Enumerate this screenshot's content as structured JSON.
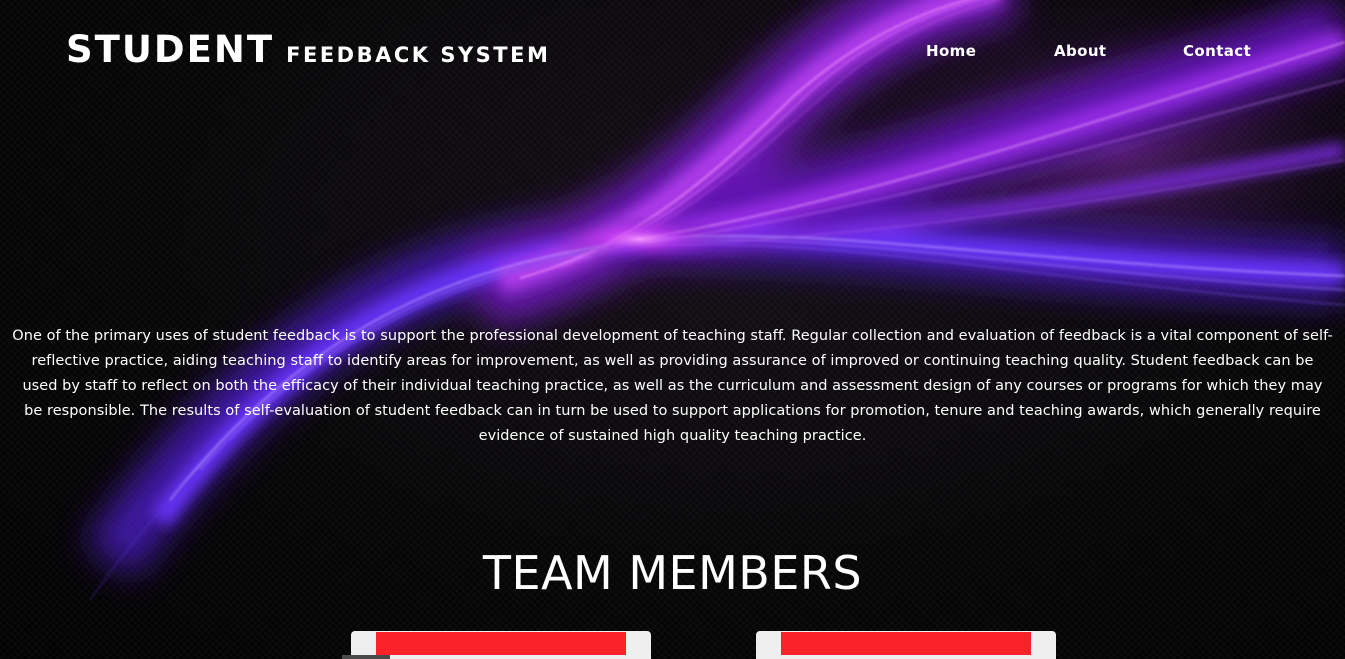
{
  "header": {
    "logo_main": "STUDENT",
    "logo_sub": "FEEDBACK SYSTEM",
    "nav": [
      "Home",
      "About",
      "Contact"
    ]
  },
  "intro": {
    "text": "One of the primary uses of student feedback is to support the professional development of teaching staff. Regular collection and evaluation of feedback is a vital component of self-reflective practice, aiding teaching staff to identify areas for improvement, as well as providing assurance of improved or continuing teaching quality. Student feedback can be used by staff to reflect on both the efficacy of their individual teaching practice, as well as the curriculum and assessment design of any courses or programs for which they may be responsible. The results of self-evaluation of student feedback can in turn be used to support applications for promotion, tenure and teaching awards, which generally require evidence of sustained high quality teaching practice."
  },
  "team": {
    "title": "TEAM MEMBERS"
  },
  "colors": {
    "background": "#000000",
    "text": "#ffffff",
    "swoosh_purple": "#8a2be2",
    "swoosh_magenta": "#e040fb",
    "swoosh_blue": "#3d3dff",
    "card_accent": "#fb2329",
    "card_bg": "#efefef"
  }
}
